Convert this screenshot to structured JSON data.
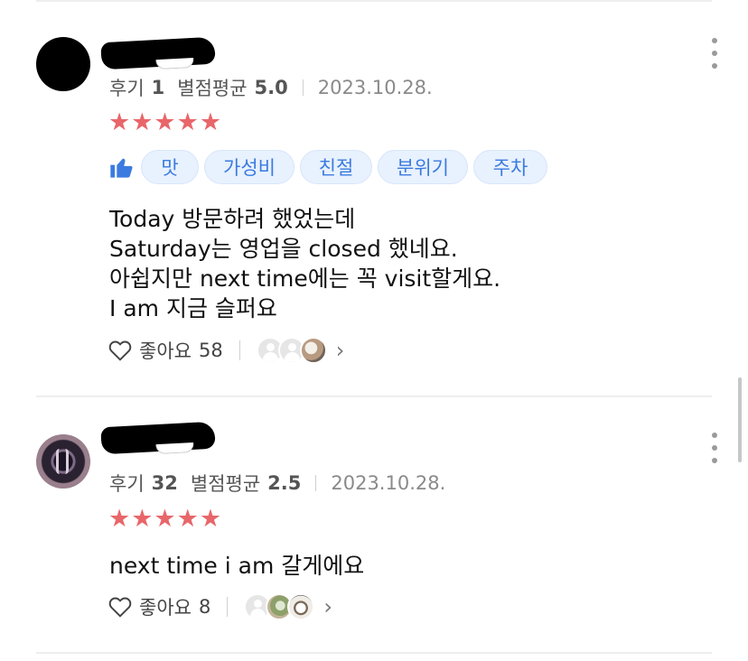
{
  "reviews": [
    {
      "review_count_label": "후기",
      "review_count": "1",
      "avg_rating_label": "별점평균",
      "avg_rating": "5.0",
      "date": "2023.10.28.",
      "stars": "★★★★★",
      "tags": [
        "맛",
        "가성비",
        "친절",
        "분위기",
        "주차"
      ],
      "text_lines": [
        "Today 방문하려 했었는데",
        "Saturday는 영업을 closed 했네요.",
        "아쉽지만 next time에는 꼭 visit할게요.",
        "I am 지금 슬퍼요"
      ],
      "like_label": "좋아요",
      "like_count": "58"
    },
    {
      "review_count_label": "후기",
      "review_count": "32",
      "avg_rating_label": "별점평균",
      "avg_rating": "2.5",
      "date": "2023.10.28.",
      "stars": "★★★★★",
      "text_lines": [
        "next time  i am 갈게에요"
      ],
      "like_label": "좋아요",
      "like_count": "8"
    }
  ],
  "icons": {
    "thumb": "thumbs-up-icon",
    "heart": "heart-outline-icon",
    "more": "more-vertical-icon",
    "chevron": "chevron-right-icon"
  },
  "colors": {
    "star": "#e8666a",
    "chip_bg": "#e8f1fe",
    "chip_text": "#3b7be0",
    "thumb": "#3b7be0"
  }
}
